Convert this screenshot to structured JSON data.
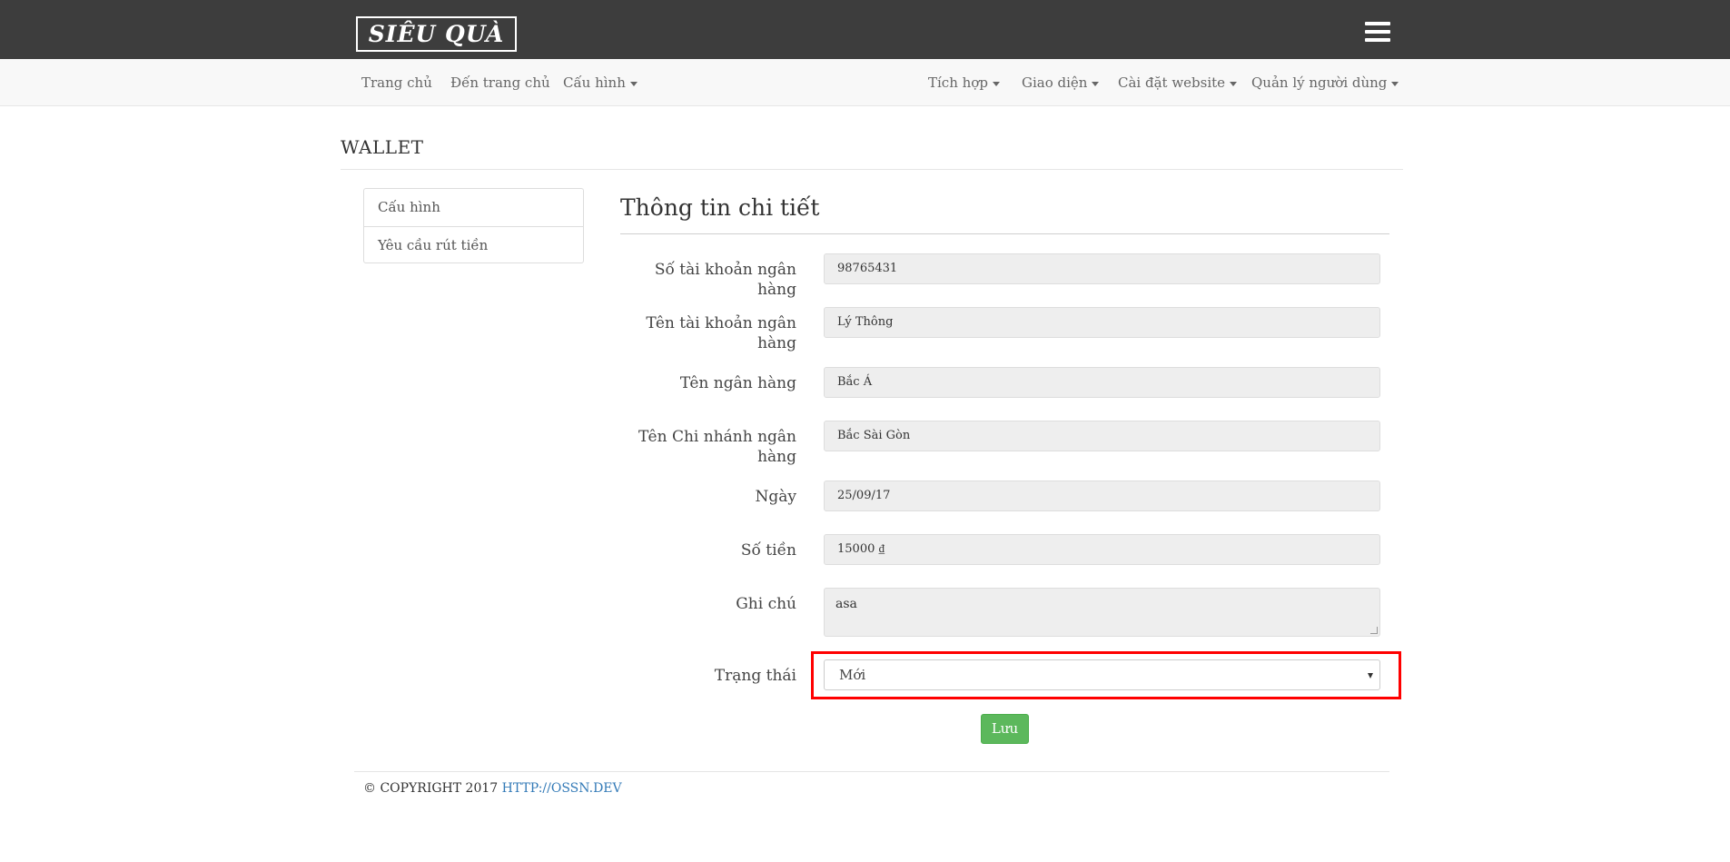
{
  "header": {
    "logo_text": "SIÊU QUÀ",
    "menu_icon": "hamburger-menu-icon"
  },
  "nav": {
    "left": [
      {
        "label": "Trang chủ",
        "dropdown": false
      },
      {
        "label": "Đến trang chủ",
        "dropdown": false
      },
      {
        "label": "Cấu hình",
        "dropdown": true
      }
    ],
    "right": [
      {
        "label": "Tích hợp",
        "dropdown": true
      },
      {
        "label": "Giao diện",
        "dropdown": true
      },
      {
        "label": "Cài đặt website",
        "dropdown": true
      },
      {
        "label": "Quản lý người dùng",
        "dropdown": true
      }
    ]
  },
  "page": {
    "title": "WALLET"
  },
  "sidebar": {
    "items": [
      {
        "label": "Cấu hình"
      },
      {
        "label": "Yêu cầu rút tiền"
      }
    ]
  },
  "form": {
    "title": "Thông tin chi tiết",
    "fields": {
      "bank_account_number": {
        "label": "Số tài khoản ngân hàng",
        "value": "98765431"
      },
      "bank_account_name": {
        "label_line1": "Tên tài khoản ngân",
        "label_line2": "hàng",
        "value": "Lý Thông"
      },
      "bank_name": {
        "label": "Tên ngân hàng",
        "value": "Bắc Á"
      },
      "branch_name": {
        "label_line1": "Tên Chi nhánh ngân",
        "label_line2": "hàng",
        "value": "Bắc Sài Gòn"
      },
      "date": {
        "label": "Ngày",
        "value": "25/09/17"
      },
      "amount": {
        "label": "Số tiền",
        "value": "15000 ₫"
      },
      "note": {
        "label": "Ghi chú",
        "value": "asa"
      },
      "status": {
        "label": "Trạng thái",
        "selected": "Mới"
      }
    },
    "save_label": "Lưu"
  },
  "footer": {
    "copyright": "© COPYRIGHT 2017",
    "link_text": "HTTP://OSSN.DEV"
  },
  "colors": {
    "header_bg": "#3d3d3d",
    "navbar_bg": "#f8f8f8",
    "save_button": "#5cb85c",
    "highlight_border": "#ff0000",
    "link": "#337ab7"
  }
}
